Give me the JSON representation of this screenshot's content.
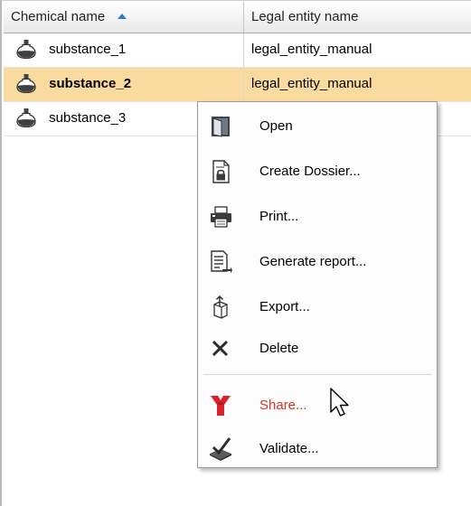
{
  "table": {
    "columns": [
      {
        "label": "Chemical name",
        "sort": "ascending"
      },
      {
        "label": "Legal entity name"
      }
    ],
    "rows": [
      {
        "name": "substance_1",
        "entity": "legal_entity_manual",
        "selected": false
      },
      {
        "name": "substance_2",
        "entity": "legal_entity_manual",
        "selected": true
      },
      {
        "name": "substance_3",
        "entity": "",
        "selected": false
      }
    ]
  },
  "context_menu": {
    "items": [
      {
        "label": "Open",
        "icon": "open-icon"
      },
      {
        "label": "Create Dossier...",
        "icon": "dossier-lock-icon"
      },
      {
        "label": "Print...",
        "icon": "printer-icon"
      },
      {
        "label": "Generate report...",
        "icon": "report-icon"
      },
      {
        "label": "Export...",
        "icon": "export-icon"
      },
      {
        "label": "Delete",
        "icon": "delete-x-icon"
      },
      {
        "label": "Share...",
        "icon": "share-icon",
        "color": "#d2352a"
      },
      {
        "label": "Validate...",
        "icon": "validate-check-icon"
      }
    ]
  },
  "colors": {
    "selected_row": "#f9dba0",
    "share_text": "#d2352a",
    "sort_arrow": "#3a78c8"
  }
}
